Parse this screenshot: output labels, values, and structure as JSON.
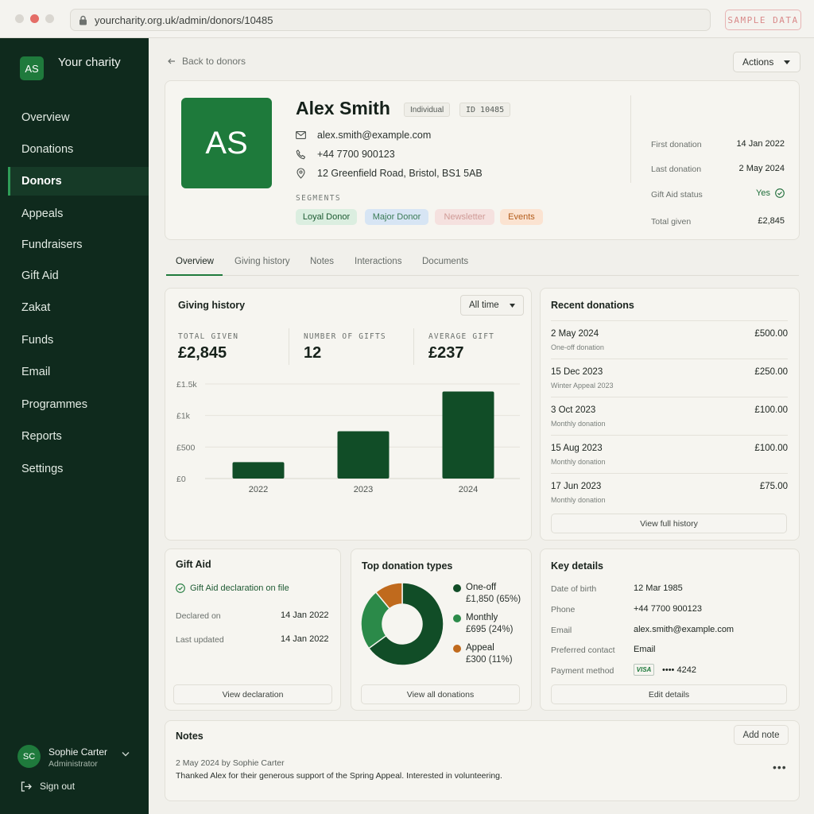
{
  "browser": {
    "url": "yourcharity.org.uk/admin/donors/10485",
    "sample_label": "SAMPLE DATA"
  },
  "sidebar": {
    "logo": "AS",
    "brand": "Your charity",
    "items": [
      {
        "label": "Overview"
      },
      {
        "label": "Donations"
      },
      {
        "label": "Donors"
      },
      {
        "label": "Appeals"
      },
      {
        "label": "Fundraisers"
      },
      {
        "label": "Gift Aid"
      },
      {
        "label": "Zakat"
      },
      {
        "label": "Funds"
      },
      {
        "label": "Email"
      },
      {
        "label": "Programmes"
      },
      {
        "label": "Reports"
      },
      {
        "label": "Settings"
      }
    ],
    "active_index": 2,
    "user": {
      "initials": "SC",
      "name": "Sophie Carter",
      "role": "Administrator"
    },
    "sign_out": "Sign out"
  },
  "header": {
    "back_label": "Back to donors",
    "actions_label": "Actions"
  },
  "profile": {
    "initials": "AS",
    "name": "Alex Smith",
    "type_tag": "Individual",
    "id_tag": "ID 10485",
    "email": "alex.smith@example.com",
    "phone": "+44 7700 900123",
    "address": "12 Greenfield Road, Bristol, BS1 5AB",
    "segments_title": "SEGMENTS",
    "segments": [
      "Loyal Donor",
      "Major Donor",
      "Newsletter",
      "Events"
    ],
    "stats": [
      {
        "label": "First donation",
        "value": "14 Jan 2022"
      },
      {
        "label": "Last donation",
        "value": "2 May 2024"
      },
      {
        "label": "Gift Aid status",
        "value": "Yes"
      },
      {
        "label": "Total given",
        "value": "£2,845"
      }
    ]
  },
  "tabs": [
    "Overview",
    "Giving history",
    "Notes",
    "Interactions",
    "Documents"
  ],
  "giving": {
    "title": "Giving history",
    "filter": "All time",
    "kpis": [
      {
        "label": "TOTAL GIVEN",
        "value": "£2,845"
      },
      {
        "label": "NUMBER OF GIFTS",
        "value": "12"
      },
      {
        "label": "AVERAGE GIFT",
        "value": "£237"
      }
    ]
  },
  "chart_data": {
    "type": "bar",
    "categories": [
      "2022",
      "2023",
      "2024"
    ],
    "values": [
      260,
      750,
      1380
    ],
    "ylim": [
      0,
      1500
    ],
    "yticks": [
      0,
      500,
      1000,
      1500
    ],
    "ytick_labels": [
      "£0",
      "£500",
      "£1k",
      "£1.5k"
    ],
    "bar_color": "#114d27",
    "grid": true
  },
  "recent": {
    "title": "Recent donations",
    "items": [
      {
        "date": "2 May 2024",
        "type": "One-off donation",
        "amount": "£500.00"
      },
      {
        "date": "15 Dec 2023",
        "type": "Winter Appeal 2023",
        "amount": "£250.00"
      },
      {
        "date": "3 Oct 2023",
        "type": "Monthly donation",
        "amount": "£100.00"
      },
      {
        "date": "15 Aug 2023",
        "type": "Monthly donation",
        "amount": "£100.00"
      },
      {
        "date": "17 Jun 2023",
        "type": "Monthly donation",
        "amount": "£75.00"
      }
    ],
    "button": "View full history"
  },
  "gift_aid": {
    "title": "Gift Aid",
    "status": "Gift Aid declaration on file",
    "declared_label": "Declared on",
    "declared_value": "14 Jan 2022",
    "updated_label": "Last updated",
    "updated_value": "14 Jan 2022",
    "button": "View declaration"
  },
  "donation_types": {
    "title": "Top donation types",
    "items": [
      {
        "name": "One-off",
        "value": "£1,850 (65%)",
        "share": 65,
        "color": "#114d27"
      },
      {
        "name": "Monthly",
        "value": "£695 (24%)",
        "share": 24,
        "color": "#2b8a49"
      },
      {
        "name": "Appeal",
        "value": "£300 (11%)",
        "share": 11,
        "color": "#c06a1d"
      }
    ],
    "button": "View all donations"
  },
  "key_details": {
    "title": "Key details",
    "rows": [
      {
        "label": "Date of birth",
        "value": "12 Mar 1985"
      },
      {
        "label": "Phone",
        "value": "+44 7700 900123"
      },
      {
        "label": "Email",
        "value": "alex.smith@example.com"
      },
      {
        "label": "Preferred contact",
        "value": "Email"
      },
      {
        "label": "Payment method",
        "value": "•••• 4242"
      }
    ],
    "card_brand": "VISA",
    "button": "Edit details"
  },
  "notes": {
    "title": "Notes",
    "add_button": "Add note",
    "note_date": "2 May 2024",
    "note_by": "by",
    "note_author": "Sophie Carter",
    "note_text": "Thanked Alex for their generous support of the Spring Appeal. Interested in volunteering.",
    "more": "•••"
  },
  "colors": {
    "sidebar_bg": "#0f2a1d",
    "brand_green": "#1f7a3c",
    "accent_orange": "#c06a1d"
  }
}
